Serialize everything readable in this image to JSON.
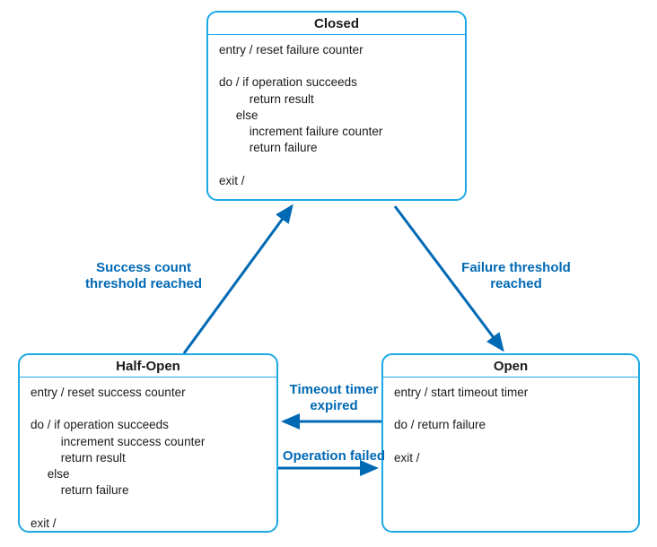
{
  "states": {
    "closed": {
      "title": "Closed",
      "body": "entry / reset failure counter\n\ndo / if operation succeeds\n         return result\n     else\n         increment failure counter\n         return failure\n\nexit /"
    },
    "halfopen": {
      "title": "Half-Open",
      "body": "entry / reset success counter\n\ndo / if operation succeeds\n         increment success counter\n         return result\n     else\n         return failure\n\nexit /"
    },
    "open": {
      "title": "Open",
      "body": "entry / start timeout timer\n\ndo / return failure\n\nexit /"
    }
  },
  "transitions": {
    "success_count": "Success count\nthreshold reached",
    "failure_threshold": "Failure threshold\nreached",
    "timeout_expired": "Timeout timer\nexpired",
    "operation_failed": "Operation failed"
  },
  "colors": {
    "border": "#1ca9e6",
    "arrow": "#0069b4",
    "label": "#0069b4"
  }
}
